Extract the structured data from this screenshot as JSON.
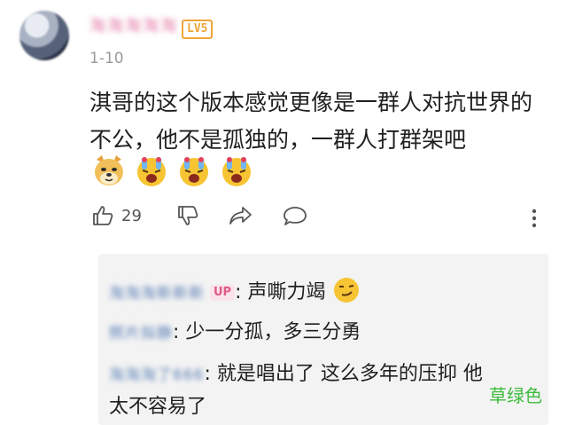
{
  "comment": {
    "username": "淘淘淘淘淘",
    "level_badge": "LV5",
    "date": "1-10",
    "text": "淇哥的这个版本感觉更像是一群人对抗世界的不公，他不是孤独的，一群人打群架吧",
    "emojis": [
      "doge-emoji",
      "crying-face-emoji",
      "crying-face-emoji",
      "crying-face-emoji"
    ],
    "like_count": "29"
  },
  "replies": [
    {
      "name": "淘淘淘新新新",
      "badge": "UP",
      "text": "声嘶力竭"
    },
    {
      "name": "照片拟静",
      "text": "少一分孤，多三分勇"
    },
    {
      "name": "淘淘淘了666",
      "text": "就是唱出了 这么多年的压抑 他太不容易了"
    }
  ],
  "watermark": "草绿色"
}
